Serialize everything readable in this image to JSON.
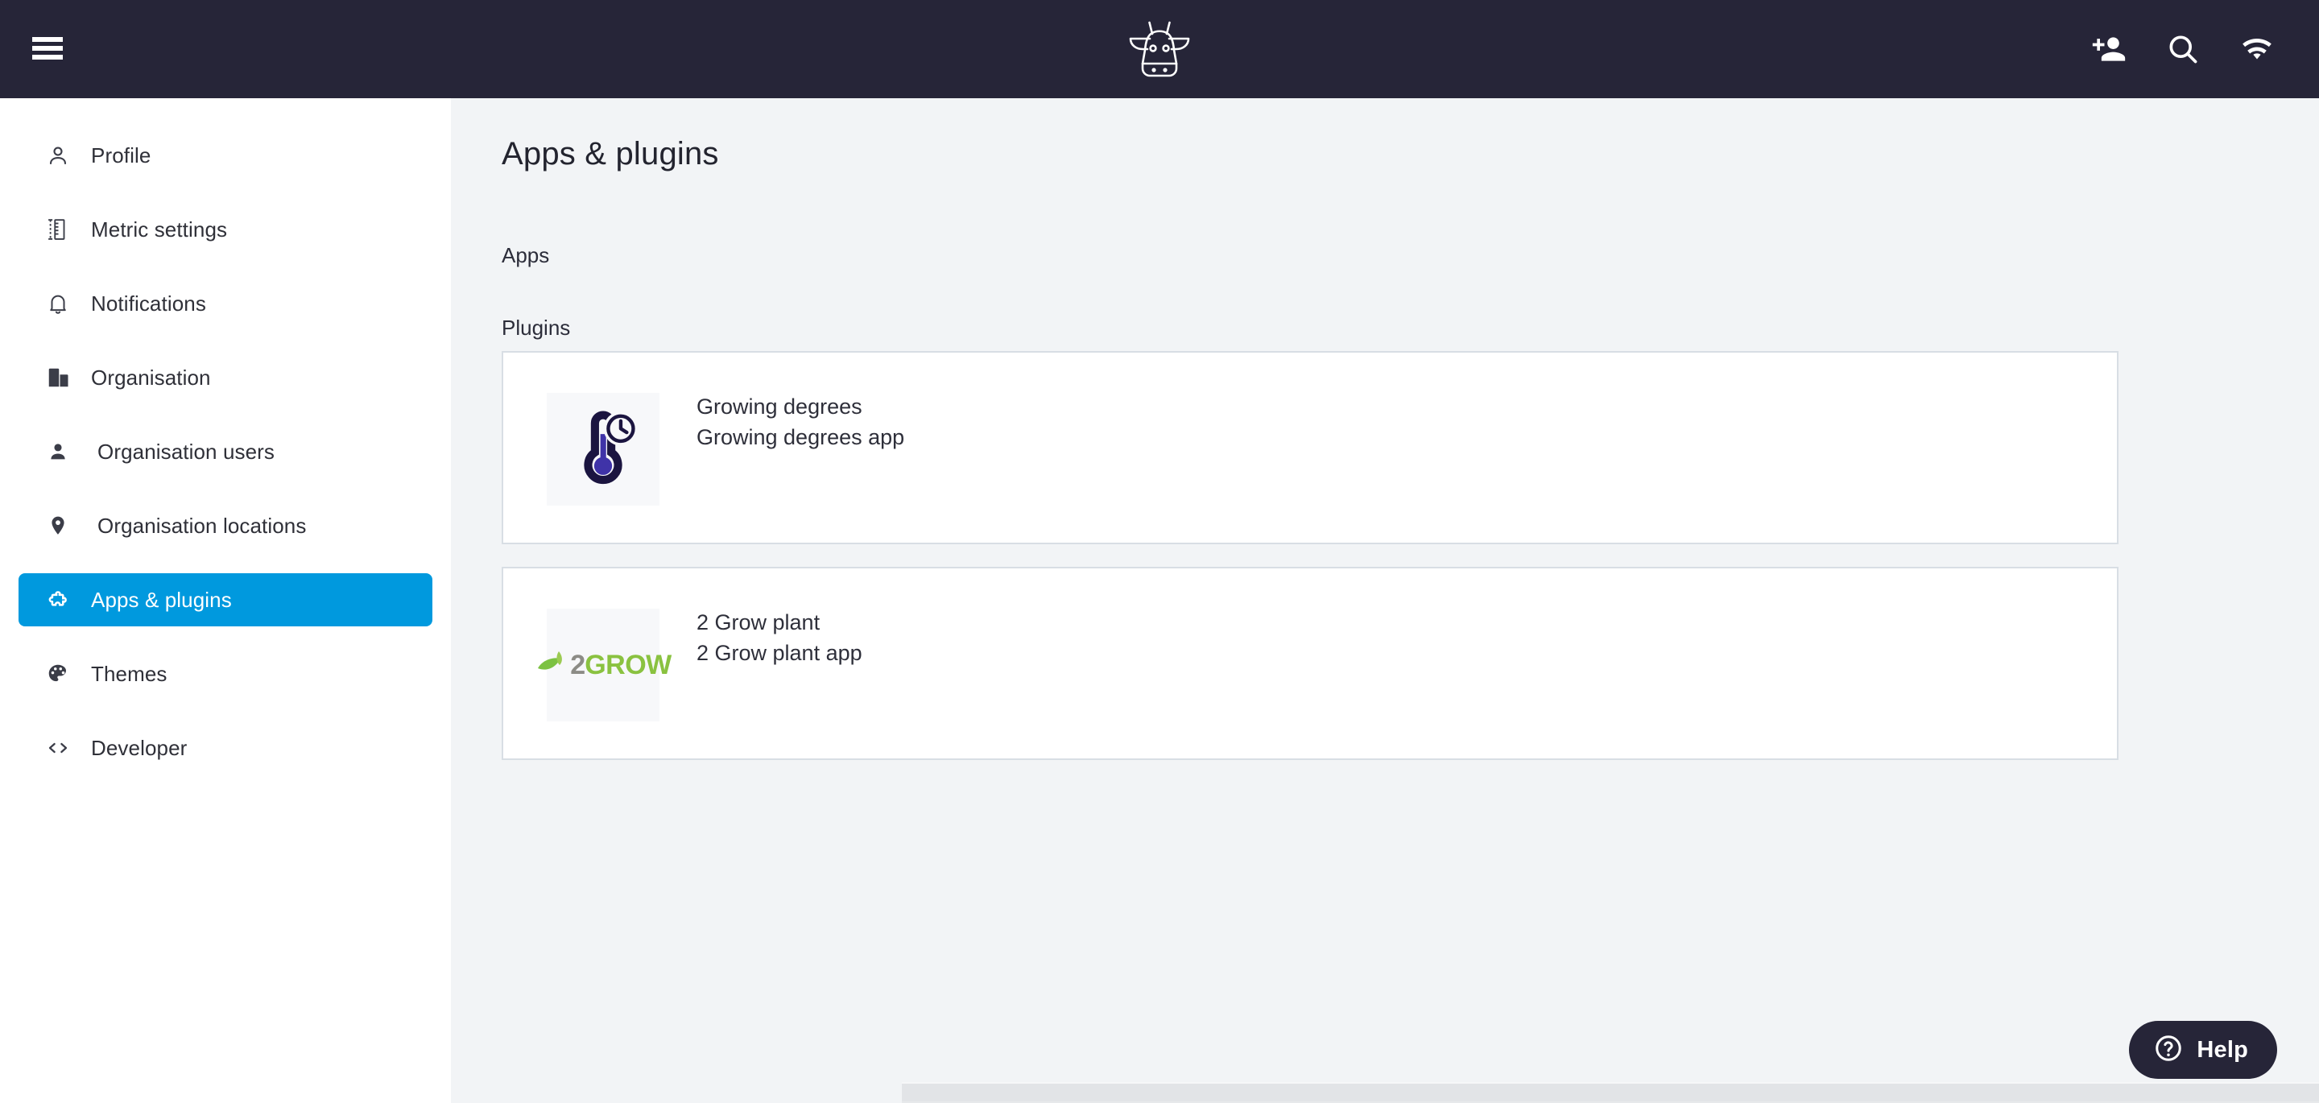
{
  "theme": {
    "topbar_bg": "#262538",
    "accent_blue": "#0099DE",
    "content_bg": "#f2f4f6",
    "card_border": "#d8dee4",
    "text_dark": "#2e2f3a"
  },
  "topbar": {
    "menu_icon": "hamburger-menu-icon",
    "logo_icon": "cow-head-logo",
    "actions": [
      {
        "name": "add-user-icon",
        "icon": "person-add-icon"
      },
      {
        "name": "search-icon",
        "icon": "magnifying-glass-icon"
      },
      {
        "name": "wifi-icon",
        "icon": "wifi-signal-icon"
      }
    ]
  },
  "sidebar": {
    "items": [
      {
        "label": "Profile",
        "icon": "person-outline-icon",
        "active": false,
        "indent": false
      },
      {
        "label": "Metric settings",
        "icon": "ruler-icon",
        "active": false,
        "indent": false
      },
      {
        "label": "Notifications",
        "icon": "bell-icon",
        "active": false,
        "indent": false
      },
      {
        "label": "Organisation",
        "icon": "building-icon",
        "active": false,
        "indent": false
      },
      {
        "label": "Organisation users",
        "icon": "person-filled-icon",
        "active": false,
        "indent": true
      },
      {
        "label": "Organisation locations",
        "icon": "map-pin-icon",
        "active": false,
        "indent": true
      },
      {
        "label": "Apps & plugins",
        "icon": "puzzle-piece-icon",
        "active": true,
        "indent": false
      },
      {
        "label": "Themes",
        "icon": "palette-icon",
        "active": false,
        "indent": false
      },
      {
        "label": "Developer",
        "icon": "code-brackets-icon",
        "active": false,
        "indent": false
      }
    ]
  },
  "main": {
    "page_title": "Apps & plugins",
    "sections": {
      "apps_label": "Apps",
      "plugins_label": "Plugins"
    },
    "plugins": [
      {
        "title": "Growing degrees",
        "subtitle": "Growing degrees app",
        "thumb_icon": "thermometer-clock-icon"
      },
      {
        "title": "2 Grow plant",
        "subtitle": "2 Grow plant app",
        "thumb_icon": "2grow-leaf-logo",
        "logo_text_prefix": "2",
        "logo_text_suffix": "GROW"
      }
    ]
  },
  "help_widget": {
    "label": "Help",
    "icon": "question-mark-circle-icon"
  }
}
